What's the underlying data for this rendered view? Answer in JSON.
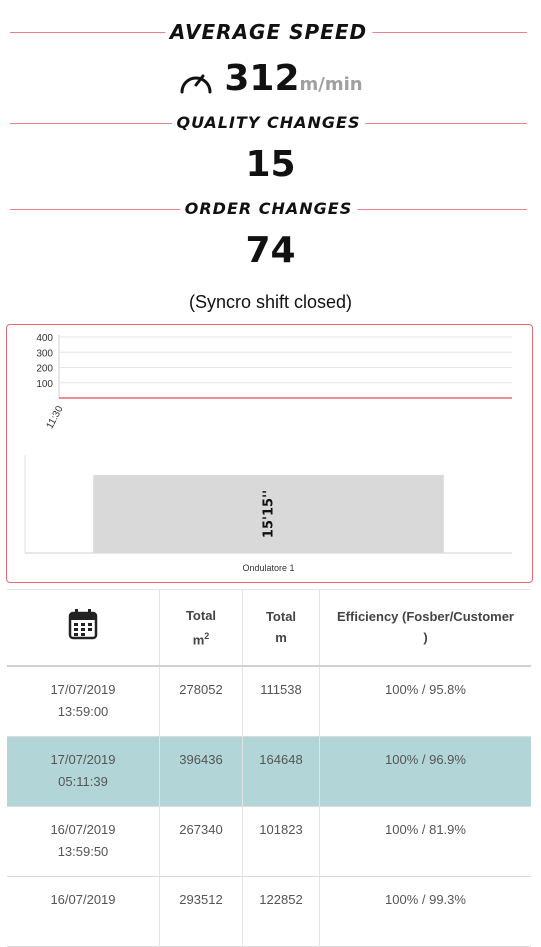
{
  "avg_speed": {
    "title": "AVERAGE SPEED",
    "value": "312",
    "unit": "m/min",
    "icon": "gauge-icon"
  },
  "quality_changes": {
    "title": "QUALITY CHANGES",
    "value": "15"
  },
  "order_changes": {
    "title": "ORDER CHANGES",
    "value": "74"
  },
  "status_note": "(Syncro shift closed)",
  "chart_data": [
    {
      "type": "line",
      "title": "",
      "ylim": [
        0,
        400
      ],
      "yticks": [
        "400",
        "300",
        "200",
        "100"
      ],
      "x_ticks": [
        "11:30"
      ],
      "series": [
        {
          "values": [
            0
          ]
        }
      ],
      "accent": "#e56b73"
    },
    {
      "type": "bar",
      "categories": [
        "Ondulatore 1"
      ],
      "values": [
        15.25
      ],
      "data_labels": [
        "15'15''"
      ],
      "bar_color": "#d9d9d9"
    }
  ],
  "table": {
    "headers": {
      "date_icon": "calendar-icon",
      "total_m2": "Total",
      "total_m2_unit": "m",
      "total_m2_sup": "2",
      "total_m": "Total",
      "total_m_unit": "m",
      "efficiency": "Efficiency (Fosber/Customer",
      "efficiency_end": ")"
    },
    "rows": [
      {
        "date": "17/07/2019",
        "time": "13:59:00",
        "m2": "278052",
        "m": "111538",
        "eff": "100% / 95.8%"
      },
      {
        "date": "17/07/2019",
        "time": "05:11:39",
        "m2": "396436",
        "m": "164648",
        "eff": "100% / 96.9%"
      },
      {
        "date": "16/07/2019",
        "time": "13:59:50",
        "m2": "267340",
        "m": "101823",
        "eff": "100% / 81.9%"
      },
      {
        "date": "16/07/2019",
        "time": "",
        "m2": "293512",
        "m": "122852",
        "eff": "100% / 99.3%"
      }
    ]
  },
  "colors": {
    "accent": "#e8848c",
    "selected_row": "#b2d6d7"
  }
}
